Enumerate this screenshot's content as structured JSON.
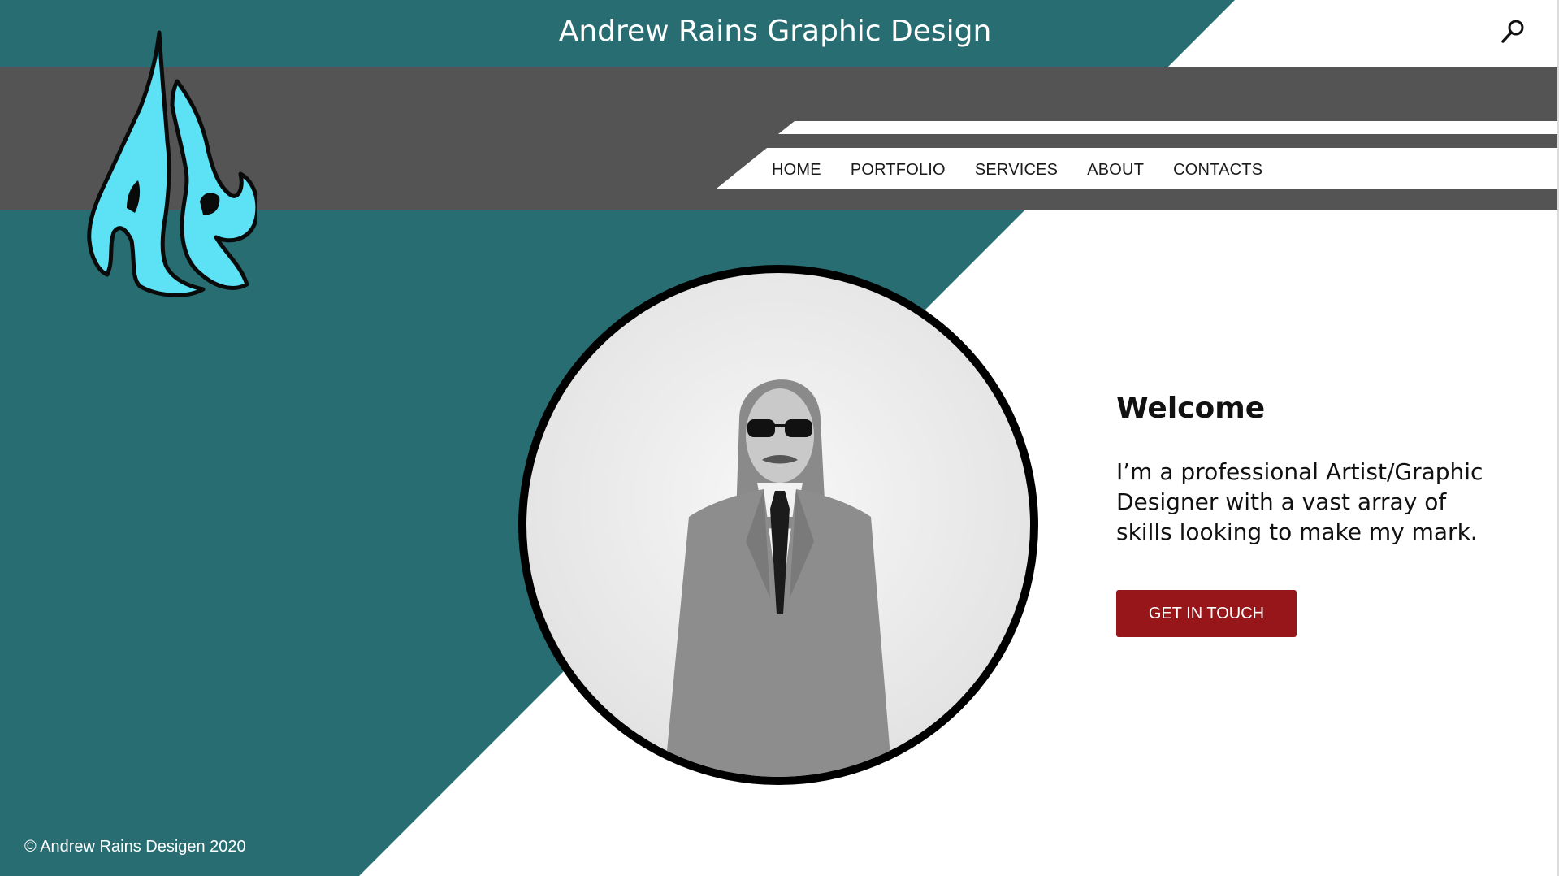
{
  "header": {
    "title": "Andrew Rains Graphic Design",
    "search_icon": "search-icon"
  },
  "logo": {
    "icon": "ar-water-drop-logo-icon",
    "letters": "AR"
  },
  "nav": {
    "items": [
      {
        "label": "HOME"
      },
      {
        "label": "PORTFOLIO"
      },
      {
        "label": "SERVICES"
      },
      {
        "label": "ABOUT"
      },
      {
        "label": "CONTACTS"
      }
    ]
  },
  "hero": {
    "heading": "Welcome",
    "body": "I’m a professional Artist/Graphic Designer with a vast array of skills looking to make my mark.",
    "cta_label": "GET IN TOUCH"
  },
  "footer": {
    "copyright": "© Andrew Rains Desigen 2020"
  },
  "colors": {
    "teal": "#276d71",
    "charcoal": "#545454",
    "accent_red": "#97161a",
    "logo_cyan": "#5ce1f5",
    "white": "#ffffff"
  }
}
